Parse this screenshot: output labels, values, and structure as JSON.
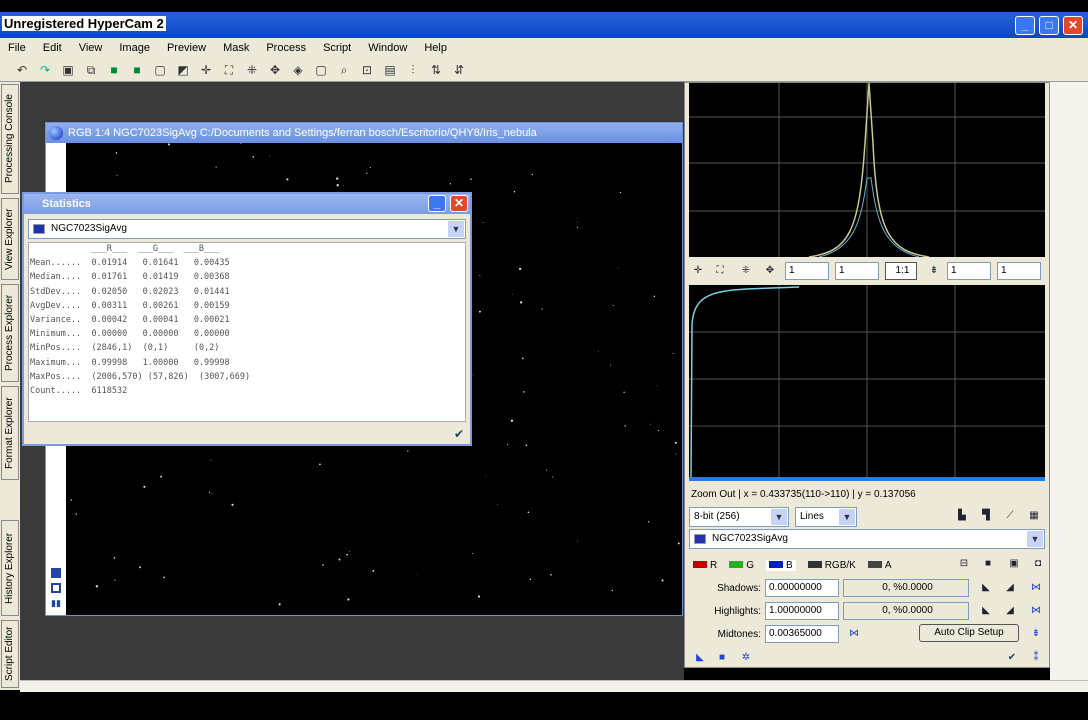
{
  "window": {
    "title": "Unregistered HyperCam 2",
    "min": "_",
    "max": "□",
    "close": "✕"
  },
  "menu": [
    "File",
    "Edit",
    "View",
    "Image",
    "Preview",
    "Mask",
    "Process",
    "Script",
    "Window",
    "Help"
  ],
  "side_tabs": [
    "Processing Console",
    "View Explorer",
    "Process Explorer",
    "Format Explorer",
    "History Explorer",
    "Script Editor"
  ],
  "image_window": {
    "title": "RGB 1:4 NGC7023SigAvg C:/Documents and Settings/ferran bosch/Escritorio/QHY8/Iris_nebula"
  },
  "statistics": {
    "title": "Statistics",
    "view": "NGC7023SigAvg",
    "headers": [
      "R",
      "G",
      "B"
    ],
    "rows": [
      {
        "label": "Mean......",
        "values": [
          "0.01914",
          "0.01641",
          "0.00435"
        ]
      },
      {
        "label": "Median....",
        "values": [
          "0.01761",
          "0.01419",
          "0.00368"
        ]
      },
      {
        "label": "StdDev....",
        "values": [
          "0.02050",
          "0.02023",
          "0.01441"
        ]
      },
      {
        "label": "AvgDev....",
        "values": [
          "0.00311",
          "0.00261",
          "0.00159"
        ]
      },
      {
        "label": "Variance..",
        "values": [
          "0.00042",
          "0.00041",
          "0.00021"
        ]
      },
      {
        "label": "Minimum...",
        "values": [
          "0.00000",
          "0.00000",
          "0.00000"
        ]
      },
      {
        "label": "MinPos....",
        "values": [
          "(2846,1)",
          "(0,1)",
          "(0,2)"
        ]
      },
      {
        "label": "Maximum...",
        "values": [
          "0.99998",
          "1.00000",
          "0.99998"
        ]
      },
      {
        "label": "MaxPos....",
        "values": [
          "(2006,570)",
          "(57,826)",
          "(3007,669)"
        ]
      },
      {
        "label": "Count.....",
        "values": [
          "6118532",
          "",
          ""
        ]
      }
    ]
  },
  "histogram": {
    "zoom_fields": [
      "1",
      "1",
      "1:1",
      "1",
      "1"
    ],
    "status": "Zoom Out | x = 0.433735(110->110) | y = 0.137056",
    "resolution": "8-bit (256)",
    "mode": "Lines",
    "view": "NGC7023SigAvg",
    "channels": [
      {
        "label": "R",
        "color": "#c00000"
      },
      {
        "label": "G",
        "color": "#20b020"
      },
      {
        "label": "B",
        "color": "#0020c0"
      },
      {
        "label": "RGB/K",
        "color": "#333333"
      },
      {
        "label": "A",
        "color": "#444444"
      }
    ],
    "shadows_label": "Shadows:",
    "shadows": "0.00000000",
    "shadows_clip": "0, %0.0000",
    "highlights_label": "Highlights:",
    "highlights": "1.00000000",
    "highlights_clip": "0, %0.0000",
    "midtones_label": "Midtones:",
    "midtones": "0.00365000",
    "auto_clip": "Auto Clip Setup"
  }
}
